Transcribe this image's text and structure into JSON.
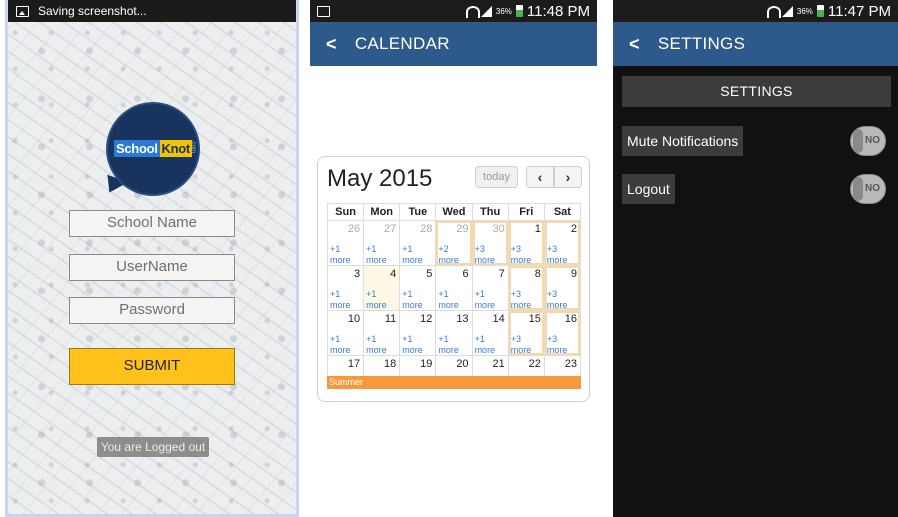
{
  "login": {
    "status_text": "Saving screenshot...",
    "logo_school": "School",
    "logo_knot": "Knot",
    "logo_com": ".com",
    "school_placeholder": "School Name",
    "username_placeholder": "UserName",
    "password_placeholder": "Password",
    "submit_label": "SUBMIT",
    "toast": "You are Logged out"
  },
  "calendar": {
    "status": {
      "battery": "36%",
      "time": "11:48 PM"
    },
    "title": "CALENDAR",
    "month": "May 2015",
    "today_label": "today",
    "prev": "‹",
    "next": "›",
    "weekdays": [
      "Sun",
      "Mon",
      "Tue",
      "Wed",
      "Thu",
      "Fri",
      "Sat"
    ],
    "weeks": [
      [
        [
          "26",
          "+1 more",
          true
        ],
        [
          "27",
          "+1 more",
          true
        ],
        [
          "28",
          "+1 more",
          true
        ],
        [
          "29",
          "+2 more",
          true
        ],
        [
          "30",
          "+3 more",
          true
        ],
        [
          "1",
          "+3 more",
          false
        ],
        [
          "2",
          "+3 more",
          false
        ]
      ],
      [
        [
          "3",
          "+1 more",
          false
        ],
        [
          "4",
          "+1 more",
          false
        ],
        [
          "5",
          "+1 more",
          false
        ],
        [
          "6",
          "+1 more",
          false
        ],
        [
          "7",
          "+1 more",
          false
        ],
        [
          "8",
          "+3 more",
          false
        ],
        [
          "9",
          "+3 more",
          false
        ]
      ],
      [
        [
          "10",
          "+1 more",
          false
        ],
        [
          "11",
          "+1 more",
          false
        ],
        [
          "12",
          "+1 more",
          false
        ],
        [
          "13",
          "+1 more",
          false
        ],
        [
          "14",
          "+1 more",
          false
        ],
        [
          "15",
          "+3 more",
          false
        ],
        [
          "16",
          "+3 more",
          false
        ]
      ],
      [
        [
          "17",
          "",
          false
        ],
        [
          "18",
          "",
          false
        ],
        [
          "19",
          "",
          false
        ],
        [
          "20",
          "",
          false
        ],
        [
          "21",
          "",
          false
        ],
        [
          "22",
          "",
          false
        ],
        [
          "23",
          "",
          false
        ]
      ]
    ],
    "event": "Summer"
  },
  "settings": {
    "status": {
      "battery": "36%",
      "time": "11:47 PM"
    },
    "title": "SETTINGS",
    "header": "SETTINGS",
    "mute_label": "Mute Notifications",
    "mute_state": "NO",
    "logout_label": "Logout",
    "logout_state": "NO"
  }
}
